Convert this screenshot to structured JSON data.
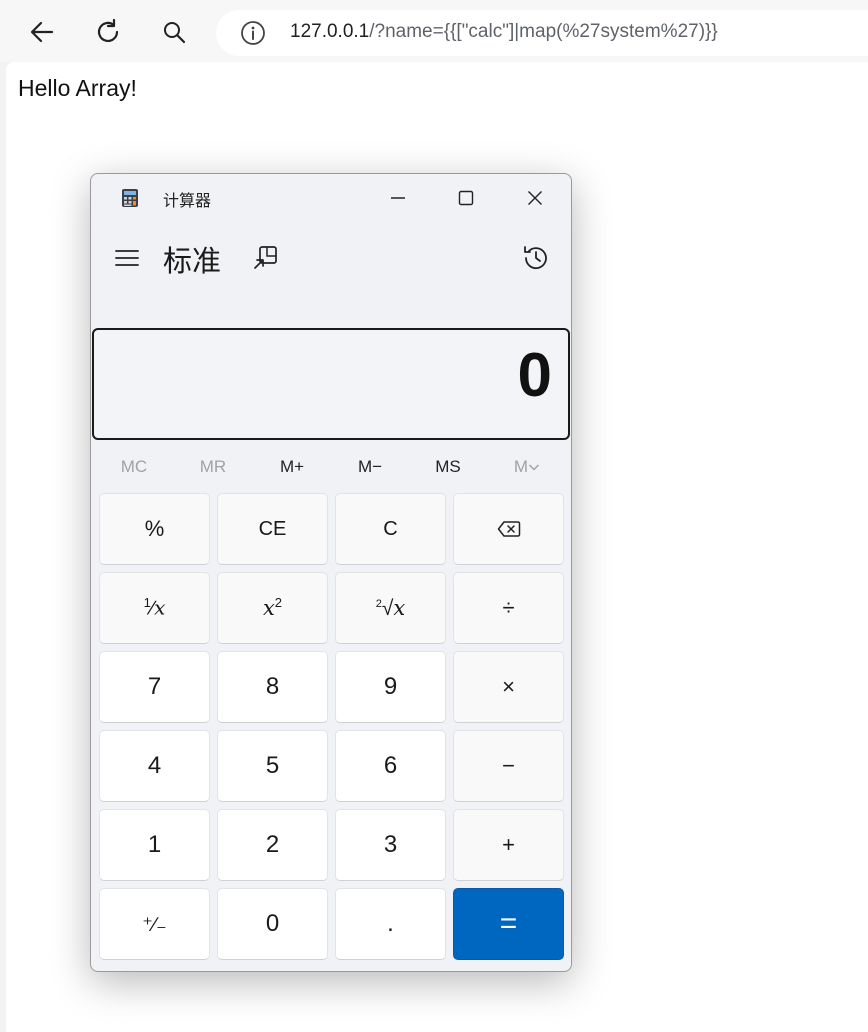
{
  "browser": {
    "url_host": "127.0.0.1",
    "url_path": "/?name={{[\"calc\"]|map(%27system%27)}}"
  },
  "page": {
    "hello_text": "Hello Array!"
  },
  "calculator": {
    "window_title": "计算器",
    "mode_title": "标准",
    "display_value": "0",
    "memory": [
      {
        "label": "MC",
        "enabled": false
      },
      {
        "label": "MR",
        "enabled": false
      },
      {
        "label": "M+",
        "enabled": true
      },
      {
        "label": "M−",
        "enabled": true
      },
      {
        "label": "MS",
        "enabled": true
      },
      {
        "label": "M∨",
        "enabled": false
      }
    ],
    "keys": {
      "percent": "%",
      "ce": "CE",
      "c": "C",
      "divide": "÷",
      "multiply": "×",
      "minus": "−",
      "plus": "+",
      "equals": "=",
      "plusminus": "⁺∕₋",
      "decimal": ".",
      "d0": "0",
      "d1": "1",
      "d2": "2",
      "d3": "3",
      "d4": "4",
      "d5": "5",
      "d6": "6",
      "d7": "7",
      "d8": "8",
      "d9": "9"
    },
    "colors": {
      "equals_bg": "#0067c0"
    }
  }
}
